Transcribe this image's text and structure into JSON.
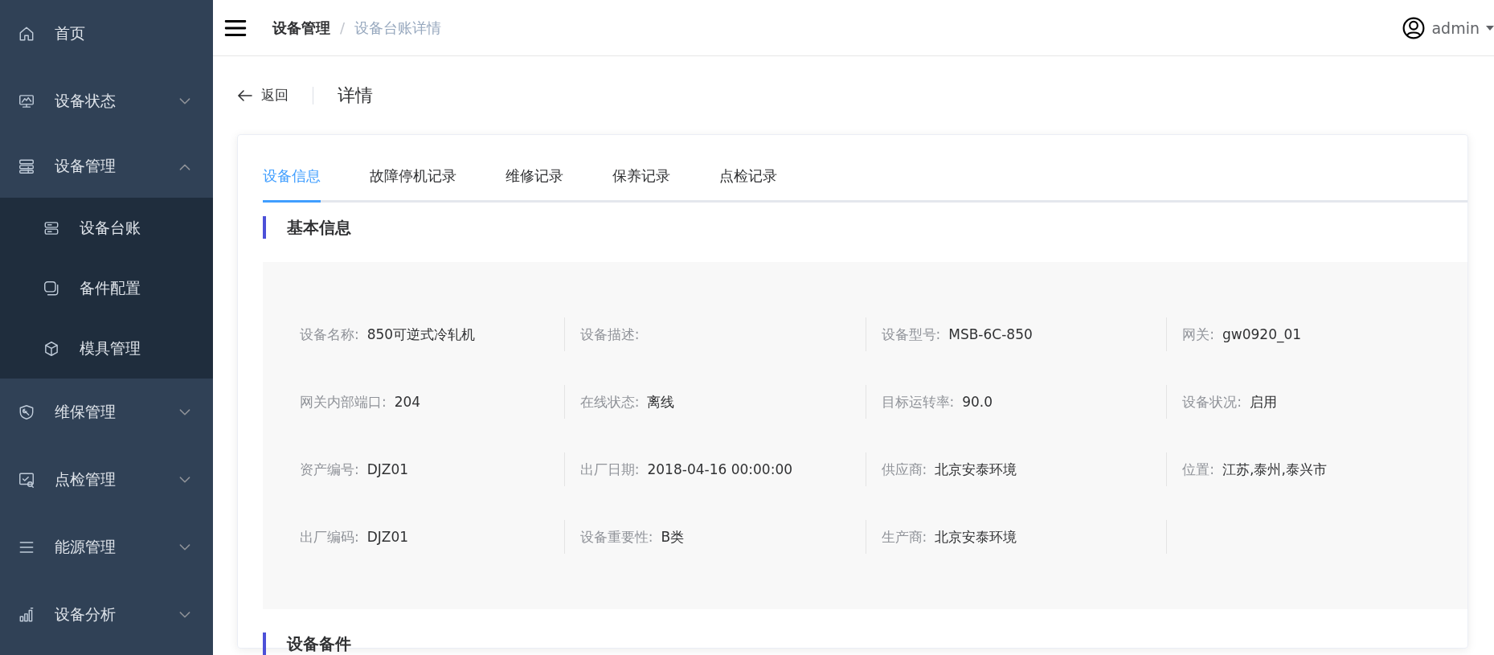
{
  "sidebar": {
    "items": [
      {
        "label": "首页"
      },
      {
        "label": "设备状态",
        "expanded": false
      },
      {
        "label": "设备管理",
        "expanded": true,
        "children": [
          {
            "label": "设备台账"
          },
          {
            "label": "备件配置"
          },
          {
            "label": "模具管理"
          }
        ]
      },
      {
        "label": "维保管理",
        "expanded": false
      },
      {
        "label": "点检管理",
        "expanded": false
      },
      {
        "label": "能源管理",
        "expanded": false
      },
      {
        "label": "设备分析",
        "expanded": false
      }
    ]
  },
  "header": {
    "breadcrumb": [
      "设备管理",
      "设备台账详情"
    ],
    "separator": "/",
    "user": "admin"
  },
  "page_header": {
    "back": "返回",
    "title": "详情"
  },
  "tabs": [
    {
      "label": "设备信息",
      "selected": true
    },
    {
      "label": "故障停机记录",
      "selected": false
    },
    {
      "label": "维修记录",
      "selected": false
    },
    {
      "label": "保养记录",
      "selected": false
    },
    {
      "label": "点检记录",
      "selected": false
    }
  ],
  "sections": [
    {
      "title": "基本信息",
      "fields": [
        {
          "label": "设备名称:",
          "value": "850可逆式冷轧机"
        },
        {
          "label": "设备描述:"
        },
        {
          "label": "设备型号:",
          "value": "MSB-6C-850"
        },
        {
          "label": "网关:",
          "value": "gw0920_01"
        },
        {
          "label": "网关内部端口:",
          "value": "204"
        },
        {
          "label": "在线状态:",
          "value": "离线"
        },
        {
          "label": "目标运转率:",
          "value": "90.0"
        },
        {
          "label": "设备状况:",
          "value": "启用"
        },
        {
          "label": "资产编号:",
          "value": "DJZ01"
        },
        {
          "label": "出厂日期:",
          "value": "2018-04-16 00:00:00"
        },
        {
          "label": "供应商:",
          "value": "北京安泰环境"
        },
        {
          "label": "位置:",
          "value": "江苏,泰州,泰兴市"
        },
        {
          "label": "出厂编码:",
          "value": "DJZ01"
        },
        {
          "label": "设备重要性:",
          "value": "B类"
        },
        {
          "label": "生产商:",
          "value": "北京安泰环境"
        }
      ]
    },
    {
      "title": "设备备件"
    }
  ]
}
